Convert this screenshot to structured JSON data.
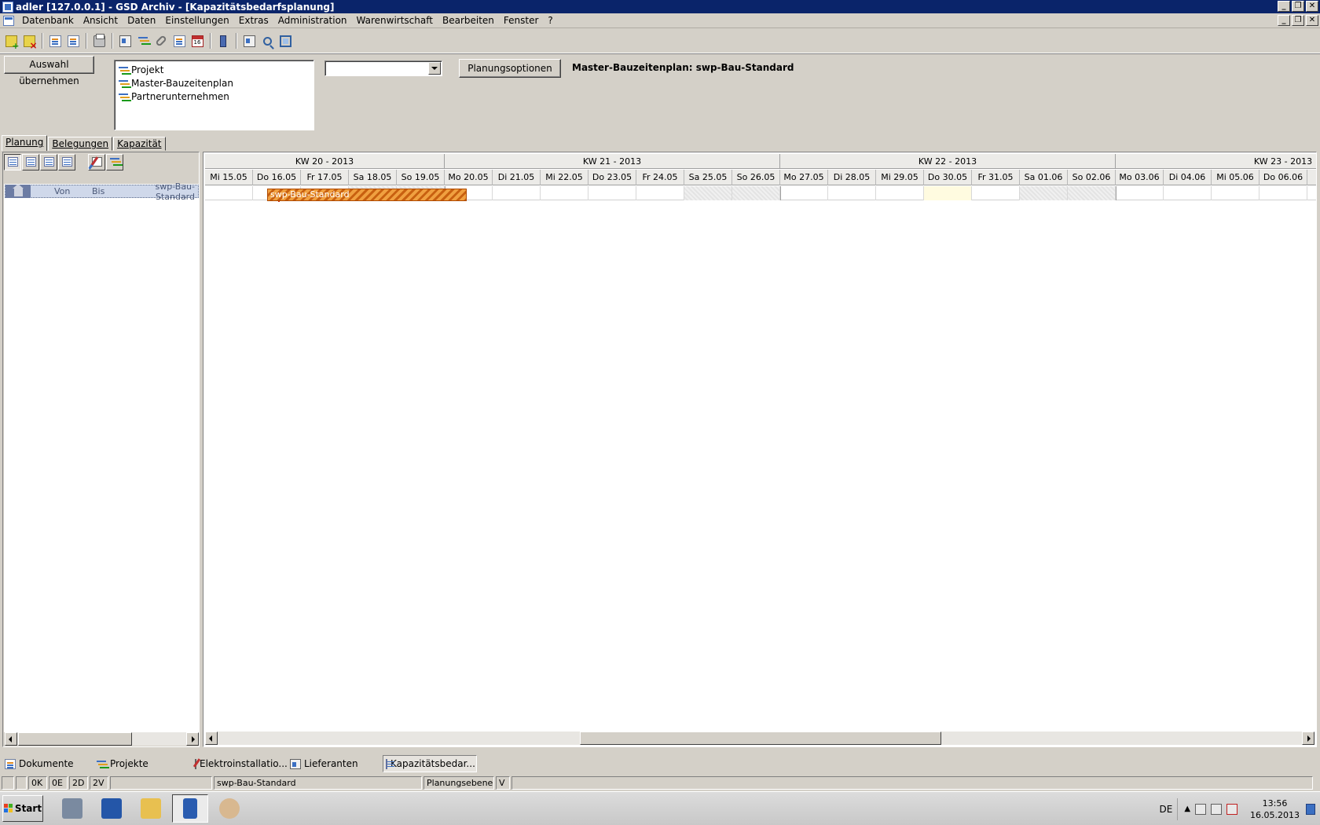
{
  "window": {
    "title": "adler [127.0.0.1] - GSD Archiv - [Kapazitätsbedarfsplanung]",
    "controls": [
      "_",
      "❐",
      "✕"
    ]
  },
  "menu": [
    "Datenbank",
    "Ansicht",
    "Daten",
    "Einstellungen",
    "Extras",
    "Administration",
    "Warenwirtschaft",
    "Bearbeiten",
    "Fenster",
    "?"
  ],
  "toolbar": {
    "icons": [
      "add-folder-icon",
      "delete-folder-icon",
      "document-import-icon",
      "document-info-icon",
      "print-icon",
      "contact-card-icon",
      "gantt-icon",
      "attachment-icon",
      "copy-document-icon",
      "calendar-icon",
      "phone-icon",
      "search-window-icon",
      "zoom-icon",
      "fit-screen-icon"
    ]
  },
  "selection": {
    "button_label": "Auswahl übernehmen",
    "tree_items": [
      "Projekt",
      "Master-Bauzeitenplan",
      "Partnerunternehmen"
    ],
    "combo_value": "",
    "planungsoptionen_label": "Planungsoptionen",
    "plan_title": "Master-Bauzeitenplan: swp-Bau-Standard"
  },
  "tabs": [
    {
      "label": "Planung",
      "active": true
    },
    {
      "label": "Belegungen",
      "active": false
    },
    {
      "label": "Kapazität",
      "active": false
    }
  ],
  "left_list": {
    "row": {
      "von": "Von",
      "bis": "Bis",
      "name": "swp-Bau-Standard"
    }
  },
  "gantt": {
    "weeks": [
      "KW 20 - 2013",
      "KW 21 - 2013",
      "KW 22 - 2013",
      "KW 23 - 2013"
    ],
    "days": [
      "Mi 15.05",
      "Do 16.05",
      "Fr 17.05",
      "Sa 18.05",
      "So 19.05",
      "Mo 20.05",
      "Di 21.05",
      "Mi 22.05",
      "Do 23.05",
      "Fr 24.05",
      "Sa 25.05",
      "So 26.05",
      "Mo 27.05",
      "Di 28.05",
      "Mi 29.05",
      "Do 30.05",
      "Fr 31.05",
      "Sa 01.06",
      "So 02.06",
      "Mo 03.06",
      "Di 04.06",
      "Mi 05.06",
      "Do 06.06"
    ],
    "bar": {
      "label": "swp-Bau-Standard",
      "start": "16.05",
      "end": "20.05"
    }
  },
  "window_tabs": [
    {
      "label": "Dokumente",
      "icon": "documents-icon",
      "active": false
    },
    {
      "label": "Projekte",
      "icon": "projects-icon",
      "active": false
    },
    {
      "label": "Elektroinstallatio...",
      "icon": "edit-icon",
      "active": false
    },
    {
      "label": "Lieferanten",
      "icon": "suppliers-icon",
      "active": false
    },
    {
      "label": "Kapazitätsbedar...",
      "icon": "capacity-icon",
      "active": true
    }
  ],
  "status": {
    "cells": [
      "",
      "",
      "0K",
      "0E",
      "2D",
      "2V",
      "",
      "swp-Bau-Standard",
      "Planungsebene",
      "V",
      ""
    ]
  },
  "taskbar": {
    "start_label": "Start",
    "lang": "DE",
    "time": "13:56",
    "date": "16.05.2013"
  }
}
